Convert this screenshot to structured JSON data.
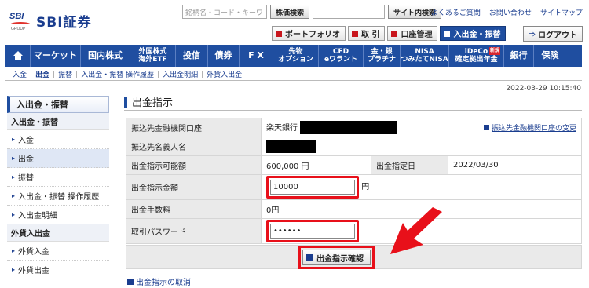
{
  "header": {
    "logo_mark": "SBI",
    "logo_group": "GROUP",
    "logo_text": "SBI証券",
    "search_placeholder": "銘柄名・コード・キーワ",
    "stock_search_label": "株価検索",
    "site_search_label": "サイト内検索",
    "links": [
      "よくあるご質問",
      "お問い合わせ",
      "サイトマップ"
    ],
    "tools": [
      "ポートフォリオ",
      "取 引",
      "口座管理",
      "入出金・振替"
    ],
    "logout_label": "ログアウト"
  },
  "nav": {
    "items": [
      "マーケット",
      "国内株式",
      "外国株式\n海外ETF",
      "投信",
      "債券",
      "F X",
      "先物\nオプション",
      "CFD\neワラント",
      "金・銀\nプラチナ",
      "NISA\nつみたてNISA",
      "iDeCo\n確定拠出年金",
      "銀行",
      "保険"
    ],
    "ideco_badge": "新規"
  },
  "subnav": {
    "items": [
      "入金",
      "出金",
      "振替",
      "入出金・振替 操作履歴",
      "入出金明細",
      "外貨入出金"
    ]
  },
  "timestamp": "2022-03-29 10:15:40",
  "sidebar": {
    "title": "入出金・振替",
    "section1": "入出金・振替",
    "items1": [
      "入金",
      "出金",
      "振替",
      "入出金・振替 操作履歴",
      "入出金明細"
    ],
    "section2": "外貨入出金",
    "items2": [
      "外貨入金",
      "外貨出金"
    ]
  },
  "main": {
    "title": "出金指示",
    "rows": {
      "bank_label": "振込先金融機関口座",
      "bank_value": "楽天銀行",
      "bank_change_link": "振込先金融機関口座の変更",
      "name_label": "振込先名義人名",
      "available_label": "出金指示可能額",
      "available_value": "600,000 円",
      "date_label": "出金指定日",
      "date_value": "2022/03/30",
      "amount_label": "出金指示金額",
      "amount_value": "10000",
      "amount_unit": "円",
      "fee_label": "出金手数料",
      "fee_value": "0円",
      "password_label": "取引パスワード",
      "password_value": "••••••"
    },
    "confirm_label": "出金指示確認",
    "cancel_label": "出金指示の取消"
  },
  "colors": {
    "brand_blue": "#1f4ea0",
    "highlight_red": "#e8101a"
  }
}
